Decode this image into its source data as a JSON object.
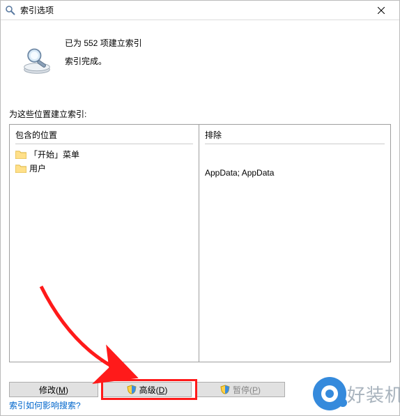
{
  "window": {
    "title": "索引选项"
  },
  "status": {
    "line1": "已为 552 项建立索引",
    "line2": "索引完成。"
  },
  "list": {
    "section_label": "为这些位置建立索引:",
    "header_left": "包含的位置",
    "header_right": "排除",
    "locations": [
      {
        "label": "「开始」菜单"
      },
      {
        "label": "用户"
      }
    ],
    "exclude_text": "AppData; AppData"
  },
  "buttons": {
    "modify": "修改(M)",
    "advanced": "高级(D)",
    "pause": "暂停(P)"
  },
  "help_link": "索引如何影响搜索?",
  "watermark": "好装机"
}
